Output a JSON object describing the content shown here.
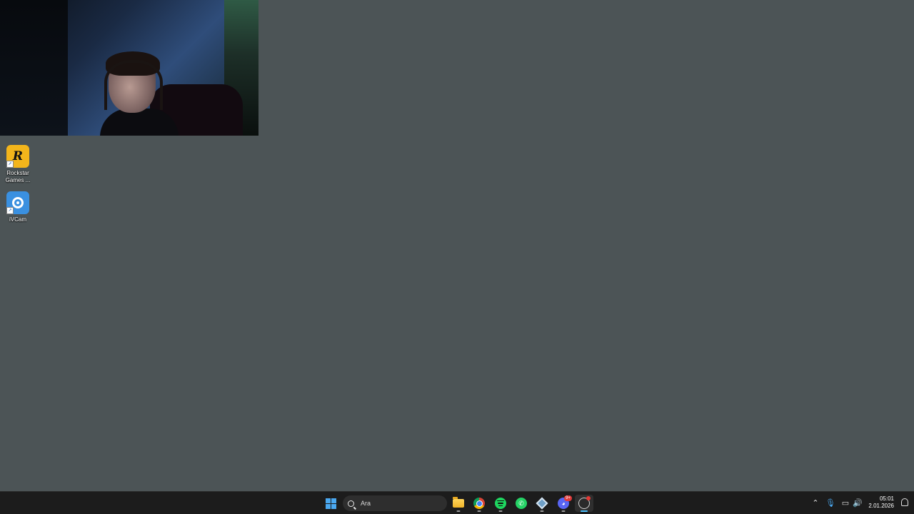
{
  "desktop": {
    "background_color": "#4c5456",
    "icons": [
      {
        "label": "Rockstar Games ...",
        "icon": "rockstar-icon",
        "glyph": "R"
      },
      {
        "label": "iVCam",
        "icon": "ivcam-icon"
      }
    ]
  },
  "webcam_overlay": {
    "description_icon": "webcam-feed"
  },
  "taskbar": {
    "search": {
      "placeholder": "Ara"
    },
    "apps": [
      {
        "name": "file-explorer",
        "icon": "folder-icon"
      },
      {
        "name": "chrome",
        "icon": "chrome-icon"
      },
      {
        "name": "spotify",
        "icon": "spotify-icon"
      },
      {
        "name": "whatsapp",
        "icon": "whatsapp-icon"
      },
      {
        "name": "app-diamond",
        "icon": "diamond-app-icon"
      },
      {
        "name": "discord",
        "icon": "discord-icon",
        "badge": "9+"
      },
      {
        "name": "steam",
        "icon": "steam-icon"
      }
    ],
    "tray": {
      "clock_time": "05:01",
      "clock_date": "2.01.2026"
    }
  }
}
